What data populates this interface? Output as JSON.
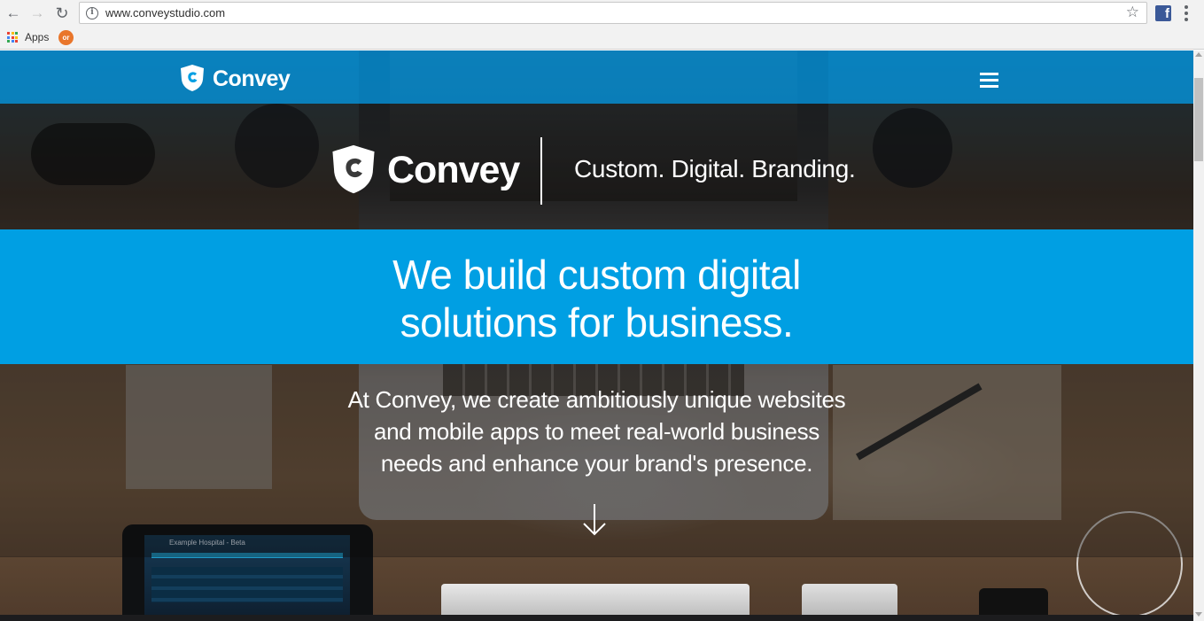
{
  "browser": {
    "url": "www.conveystudio.com",
    "bookmarks": [
      {
        "label": "Apps",
        "icon": "apps-grid-icon"
      },
      {
        "label": "",
        "icon": "orange-favicon-icon"
      }
    ],
    "icons": {
      "back": "back-arrow-icon",
      "forward": "forward-arrow-icon",
      "reload": "reload-icon",
      "info": "info-icon",
      "bookmark_star": "star-icon",
      "extension": "facebook-icon",
      "menu": "menu-dots-icon"
    },
    "fb_glyph": "f",
    "favicon_glyph": "or"
  },
  "site": {
    "brand": "Convey",
    "brand_color": "#009fe3",
    "nav": {
      "menu_icon": "hamburger-menu-icon"
    },
    "hero": {
      "brand_name": "Convey",
      "tagline": "Custom. Digital. Branding.",
      "headline_line1": "We build custom digital",
      "headline_line2": "solutions for business.",
      "desc_line1": "At Convey, we create ambitiously unique websites",
      "desc_line2": "and mobile apps to meet real-world business",
      "desc_line3": "needs and enhance your brand's presence.",
      "scroll_icon": "down-arrow-icon"
    },
    "background_photo": {
      "tablet_title": "Example Hospital - Beta"
    }
  }
}
